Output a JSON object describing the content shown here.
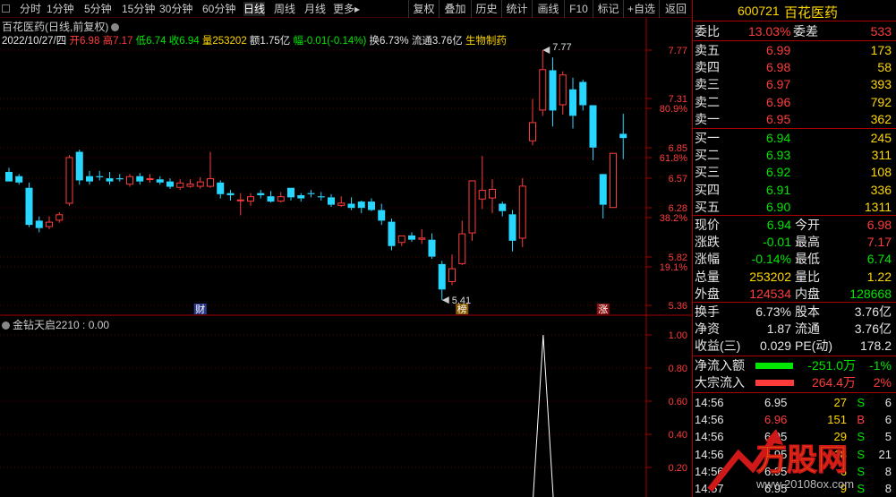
{
  "toolbar": {
    "periods": [
      "分时",
      "1分钟",
      "5分钟",
      "15分钟",
      "30分钟",
      "60分钟",
      "日线",
      "周线",
      "月线",
      "更多▸"
    ],
    "selected": "日线",
    "actions": [
      "复权",
      "叠加",
      "历史",
      "统计",
      "画线",
      "F10",
      "标记",
      "+自选",
      "返回"
    ]
  },
  "chart_header": {
    "title": "百花医药(日线,前复权)",
    "date": "2022/10/27/四",
    "open_label": "开",
    "open": "6.98",
    "high_label": "高",
    "high": "7.17",
    "low_label": "低",
    "low": "6.74",
    "close_label": "收",
    "close": "6.94",
    "volume_label": "量",
    "volume": "253202",
    "amount_label": "额",
    "amount": "1.75亿",
    "change_label": "幅",
    "change": "-0.01(-0.14%)",
    "turnover_label": "换",
    "turnover": "6.73%",
    "float_label": "流通",
    "float": "3.76亿",
    "sector": "生物制药"
  },
  "price_axis": {
    "labels": [
      "7.77",
      "7.31",
      "80.9%",
      "6.85",
      "61.8%",
      "6.57",
      "6.28",
      "38.2%",
      "5.82",
      "19.1%",
      "5.36"
    ]
  },
  "annotations": {
    "high_mark": "7.77",
    "low_mark": "5.41",
    "tags": [
      "财",
      "榜",
      "涨"
    ]
  },
  "indicator": {
    "title": "金钻天启2210 : 0.00",
    "axis": [
      "1.00",
      "0.80",
      "0.60",
      "0.40",
      "0.20"
    ]
  },
  "colors": {
    "up": "#ff3c3c",
    "down": "#00e600",
    "flat_candle": "#28d7ff"
  },
  "chart_data": {
    "type": "candlestick",
    "candles": [
      {
        "o": 6.62,
        "h": 6.66,
        "c": 6.53,
        "l": 6.53
      },
      {
        "o": 6.58,
        "h": 6.6,
        "c": 6.52,
        "l": 6.5
      },
      {
        "o": 6.47,
        "h": 6.52,
        "c": 6.12,
        "l": 6.1
      },
      {
        "o": 6.16,
        "h": 6.2,
        "c": 6.09,
        "l": 6.05
      },
      {
        "o": 6.1,
        "h": 6.2,
        "c": 6.15,
        "l": 6.08
      },
      {
        "o": 6.16,
        "h": 6.24,
        "c": 6.22,
        "l": 6.14
      },
      {
        "o": 6.32,
        "h": 6.78,
        "c": 6.76,
        "l": 6.3
      },
      {
        "o": 6.81,
        "h": 6.83,
        "c": 6.54,
        "l": 6.5
      },
      {
        "o": 6.58,
        "h": 6.63,
        "c": 6.53,
        "l": 6.5
      },
      {
        "o": 6.58,
        "h": 6.63,
        "c": 6.57,
        "l": 6.54
      },
      {
        "o": 6.56,
        "h": 6.62,
        "c": 6.53,
        "l": 6.5
      },
      {
        "o": 6.56,
        "h": 6.6,
        "c": 6.55,
        "l": 6.53
      },
      {
        "o": 6.5,
        "h": 6.6,
        "c": 6.58,
        "l": 6.48
      },
      {
        "o": 6.58,
        "h": 6.61,
        "c": 6.53,
        "l": 6.5
      },
      {
        "o": 6.55,
        "h": 6.6,
        "c": 6.56,
        "l": 6.52
      },
      {
        "o": 6.55,
        "h": 6.58,
        "c": 6.52,
        "l": 6.5
      },
      {
        "o": 6.53,
        "h": 6.56,
        "c": 6.48,
        "l": 6.46
      },
      {
        "o": 6.47,
        "h": 6.55,
        "c": 6.52,
        "l": 6.45
      },
      {
        "o": 6.48,
        "h": 6.55,
        "c": 6.51,
        "l": 6.47
      },
      {
        "o": 6.48,
        "h": 6.57,
        "c": 6.53,
        "l": 6.46
      },
      {
        "o": 6.48,
        "h": 6.81,
        "c": 6.56,
        "l": 6.47
      },
      {
        "o": 6.52,
        "h": 6.54,
        "c": 6.41,
        "l": 6.37
      },
      {
        "o": 6.42,
        "h": 6.45,
        "c": 6.4,
        "l": 6.35
      },
      {
        "o": 6.35,
        "h": 6.42,
        "c": 6.36,
        "l": 6.21
      },
      {
        "o": 6.34,
        "h": 6.42,
        "c": 6.39,
        "l": 6.3
      },
      {
        "o": 6.42,
        "h": 6.45,
        "c": 6.4,
        "l": 6.37
      },
      {
        "o": 6.39,
        "h": 6.44,
        "c": 6.34,
        "l": 6.33
      },
      {
        "o": 6.34,
        "h": 6.43,
        "c": 6.39,
        "l": 6.33
      },
      {
        "o": 6.47,
        "h": 6.47,
        "c": 6.38,
        "l": 6.35
      },
      {
        "o": 6.4,
        "h": 6.42,
        "c": 6.37,
        "l": 6.34
      },
      {
        "o": 6.42,
        "h": 6.45,
        "c": 6.41,
        "l": 6.38
      },
      {
        "o": 6.39,
        "h": 6.43,
        "c": 6.38,
        "l": 6.35
      },
      {
        "o": 6.38,
        "h": 6.41,
        "c": 6.31,
        "l": 6.29
      },
      {
        "o": 6.3,
        "h": 6.39,
        "c": 6.33,
        "l": 6.29
      },
      {
        "o": 6.32,
        "h": 6.38,
        "c": 6.28,
        "l": 6.26
      },
      {
        "o": 6.34,
        "h": 6.35,
        "c": 6.28,
        "l": 6.23
      },
      {
        "o": 6.34,
        "h": 6.37,
        "c": 6.26,
        "l": 6.25
      },
      {
        "o": 6.26,
        "h": 6.32,
        "c": 6.16,
        "l": 6.12
      },
      {
        "o": 6.15,
        "h": 6.18,
        "c": 5.92,
        "l": 5.88
      },
      {
        "o": 5.95,
        "h": 6.02,
        "c": 6.02,
        "l": 5.92
      },
      {
        "o": 6.02,
        "h": 6.05,
        "c": 5.98,
        "l": 5.96
      },
      {
        "o": 5.98,
        "h": 6.08,
        "c": 6.0,
        "l": 5.94
      },
      {
        "o": 5.98,
        "h": 6.04,
        "c": 5.82,
        "l": 5.8
      },
      {
        "o": 5.75,
        "h": 5.78,
        "c": 5.51,
        "l": 5.41
      },
      {
        "o": 5.58,
        "h": 5.84,
        "c": 5.71,
        "l": 5.55
      },
      {
        "o": 5.75,
        "h": 6.16,
        "c": 6.04,
        "l": 5.74
      },
      {
        "o": 6.04,
        "h": 6.32,
        "c": 6.54,
        "l": 5.97
      },
      {
        "o": 6.36,
        "h": 6.77,
        "c": 6.45,
        "l": 6.27
      },
      {
        "o": 6.37,
        "h": 6.55,
        "c": 6.46,
        "l": 6.23
      },
      {
        "o": 6.32,
        "h": 6.34,
        "c": 6.25,
        "l": 6.2
      },
      {
        "o": 6.22,
        "h": 6.26,
        "c": 5.97,
        "l": 5.87
      },
      {
        "o": 5.99,
        "h": 6.56,
        "c": 6.49,
        "l": 5.91
      },
      {
        "o": 6.91,
        "h": 7.31,
        "c": 7.09,
        "l": 6.87
      },
      {
        "o": 7.2,
        "h": 7.77,
        "c": 7.59,
        "l": 7.15
      },
      {
        "o": 7.58,
        "h": 7.7,
        "c": 7.2,
        "l": 7.05
      },
      {
        "o": 7.25,
        "h": 7.57,
        "c": 7.54,
        "l": 7.16
      },
      {
        "o": 7.4,
        "h": 7.51,
        "c": 7.15,
        "l": 7.03
      },
      {
        "o": 7.47,
        "h": 7.49,
        "c": 7.25,
        "l": 7.2
      },
      {
        "o": 7.25,
        "h": 7.25,
        "c": 6.85,
        "l": 6.73
      },
      {
        "o": 6.6,
        "h": 6.6,
        "c": 6.31,
        "l": 6.18
      },
      {
        "o": 6.28,
        "h": 6.8,
        "c": 6.8,
        "l": 6.28
      },
      {
        "o": 6.98,
        "h": 7.17,
        "c": 6.94,
        "l": 6.74
      }
    ]
  },
  "indicator_data": {
    "type": "line",
    "values": [
      0,
      0,
      0,
      0,
      0,
      0,
      0,
      0,
      0,
      0,
      0,
      0,
      0,
      0,
      0,
      0,
      0,
      0,
      0,
      0,
      0,
      0,
      0,
      0,
      0,
      0,
      0,
      0,
      0,
      0,
      0,
      0,
      0,
      0,
      0,
      0,
      0,
      0,
      0,
      0,
      0,
      0,
      0,
      0,
      0,
      0,
      0,
      0,
      0,
      0,
      0,
      0,
      0,
      1.0,
      0,
      0,
      0,
      0,
      0,
      0,
      0,
      0
    ]
  },
  "quote": {
    "code": "600721",
    "name": "百花医药",
    "weibi_label": "委比",
    "weibi": "13.03%",
    "weicha_label": "委差",
    "weicha": "533",
    "asks": [
      {
        "label": "卖五",
        "price": "6.99",
        "vol": "173"
      },
      {
        "label": "卖四",
        "price": "6.98",
        "vol": "58"
      },
      {
        "label": "卖三",
        "price": "6.97",
        "vol": "393"
      },
      {
        "label": "卖二",
        "price": "6.96",
        "vol": "792"
      },
      {
        "label": "卖一",
        "price": "6.95",
        "vol": "362"
      }
    ],
    "bids": [
      {
        "label": "买一",
        "price": "6.94",
        "vol": "245"
      },
      {
        "label": "买二",
        "price": "6.93",
        "vol": "311"
      },
      {
        "label": "买三",
        "price": "6.92",
        "vol": "108"
      },
      {
        "label": "买四",
        "price": "6.91",
        "vol": "336"
      },
      {
        "label": "买五",
        "price": "6.90",
        "vol": "1311"
      }
    ],
    "stats": [
      [
        {
          "l": "现价",
          "v": "6.94",
          "c": "g"
        },
        {
          "l": "今开",
          "v": "6.98",
          "c": "r"
        }
      ],
      [
        {
          "l": "涨跌",
          "v": "-0.01",
          "c": "g"
        },
        {
          "l": "最高",
          "v": "7.17",
          "c": "r"
        }
      ],
      [
        {
          "l": "涨幅",
          "v": "-0.14%",
          "c": "g"
        },
        {
          "l": "最低",
          "v": "6.74",
          "c": "g"
        }
      ],
      [
        {
          "l": "总量",
          "v": "253202",
          "c": "y"
        },
        {
          "l": "量比",
          "v": "1.22",
          "c": "y"
        }
      ],
      [
        {
          "l": "外盘",
          "v": "124534",
          "c": "r"
        },
        {
          "l": "内盘",
          "v": "128668",
          "c": "g"
        }
      ]
    ],
    "fund": [
      [
        {
          "l": "换手",
          "v": "6.73%"
        },
        {
          "l": "股本",
          "v": "3.76亿"
        }
      ],
      [
        {
          "l": "净资",
          "v": "1.87"
        },
        {
          "l": "流通",
          "v": "3.76亿"
        }
      ],
      [
        {
          "l": "收益(三)",
          "v": "0.029"
        },
        {
          "l": "PE(动)",
          "v": "178.2"
        }
      ]
    ],
    "flows": [
      {
        "l": "净流入额",
        "v": "-251.0万",
        "p": "-1%",
        "c": "g",
        "fill": 0.7
      },
      {
        "l": "大宗流入",
        "v": "264.4万",
        "p": "2%",
        "c": "r",
        "fill": 0.72
      }
    ],
    "ticks": [
      {
        "t": "14:56",
        "p": "6.95",
        "pc": "w",
        "v": "27",
        "vc": "y",
        "d": "S",
        "dc": "g",
        "n": "6"
      },
      {
        "t": "14:56",
        "p": "6.96",
        "pc": "r",
        "v": "151",
        "vc": "y",
        "d": "B",
        "dc": "r",
        "n": "6"
      },
      {
        "t": "14:56",
        "p": "6.95",
        "pc": "w",
        "v": "29",
        "vc": "y",
        "d": "S",
        "dc": "g",
        "n": "5"
      },
      {
        "t": "14:56",
        "p": "6.95",
        "pc": "w",
        "v": "18",
        "vc": "y",
        "d": "S",
        "dc": "g",
        "n": "21"
      },
      {
        "t": "14:56",
        "p": "6.95",
        "pc": "w",
        "v": "6",
        "vc": "y",
        "d": "S",
        "dc": "g",
        "n": "8"
      },
      {
        "t": "14:57",
        "p": "6.95",
        "pc": "w",
        "v": "9",
        "vc": "y",
        "d": "S",
        "dc": "g",
        "n": "8"
      }
    ]
  },
  "watermark": {
    "brand": "万股网",
    "url": "www.20108ox.com"
  }
}
